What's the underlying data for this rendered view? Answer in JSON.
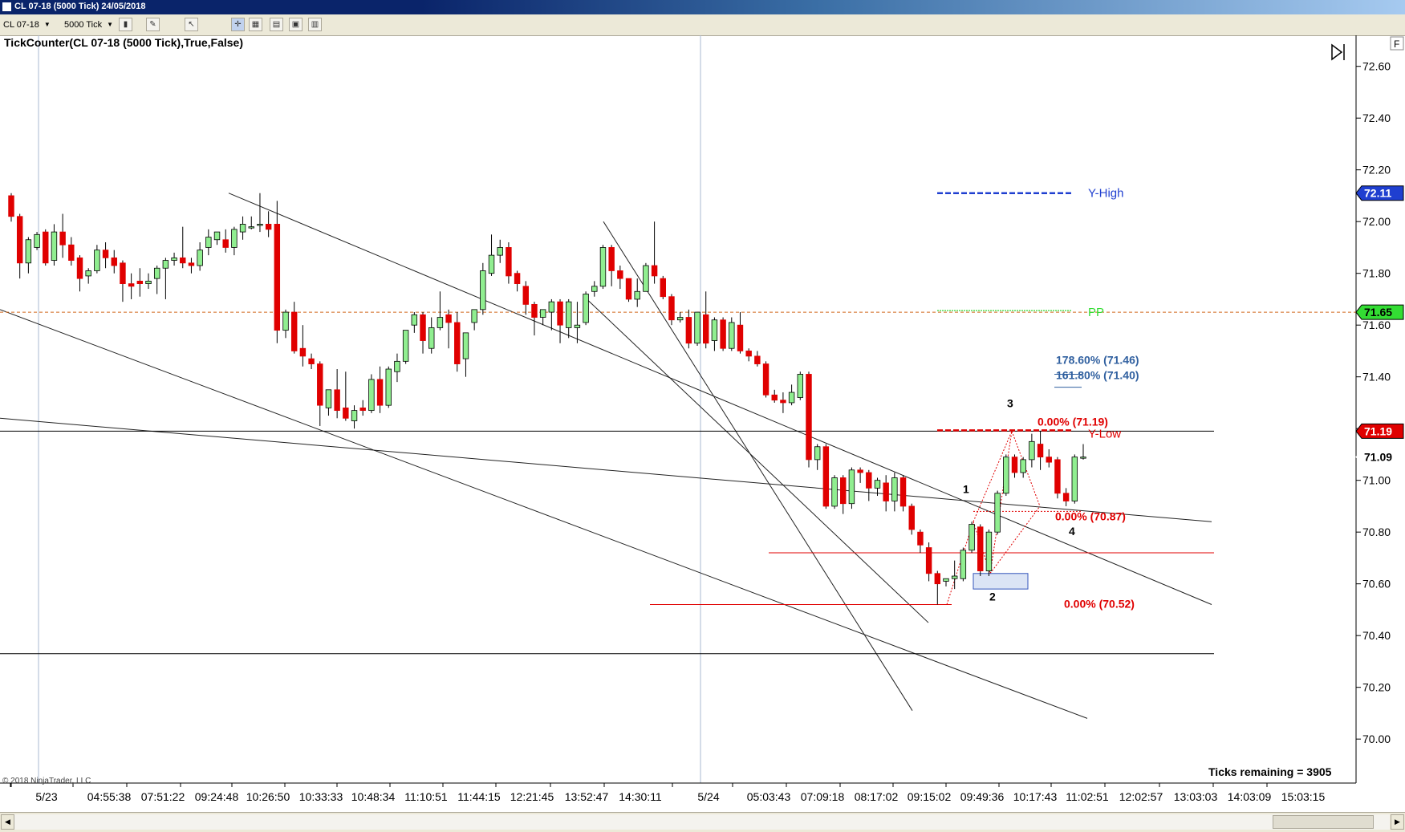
{
  "window": {
    "title": "CL 07-18 (5000 Tick)  24/05/2018"
  },
  "toolbar": {
    "instrument": "CL 07-18",
    "interval": "5000 Tick"
  },
  "icons": [
    "app-icon",
    "pencil-icon",
    "pointer-icon",
    "grid-icon",
    "chart-icon",
    "window-icon",
    "dropdown-icon",
    "f-icon",
    "play-icon"
  ],
  "chart_data": {
    "type": "candlestick",
    "title": "TickCounter(CL 07-18 (5000 Tick),True,False)",
    "yticks": [
      72.6,
      72.4,
      72.2,
      72.0,
      71.8,
      71.6,
      71.4,
      71.2,
      71.0,
      70.8,
      70.6,
      70.4,
      70.2,
      70.0
    ],
    "ytick_labels": [
      "72.60",
      "72.40",
      "72.20",
      "72.00",
      "71.80",
      "71.60",
      "71.40",
      "71.20",
      "71.00",
      "70.80",
      "70.60",
      "70.40",
      "70.20",
      "70.00"
    ],
    "ylim": [
      69.83,
      72.72
    ],
    "xtick_labels": [
      "5/23",
      "04:55:38",
      "07:51:22",
      "09:24:48",
      "10:26:50",
      "10:33:33",
      "10:48:34",
      "11:10:51",
      "11:44:15",
      "12:21:45",
      "13:52:47",
      "14:30:11",
      "5/24",
      "05:03:43",
      "07:09:18",
      "08:17:02",
      "09:15:02",
      "09:49:36",
      "10:17:43",
      "11:02:51",
      "12:02:57",
      "13:03:03",
      "14:03:09",
      "15:03:15"
    ],
    "candles": [
      {
        "o": 72.1,
        "h": 72.11,
        "c": 72.02,
        "l": 72.0
      },
      {
        "o": 72.02,
        "h": 72.03,
        "c": 71.84,
        "l": 71.78
      },
      {
        "o": 71.84,
        "h": 71.94,
        "c": 71.93,
        "l": 71.8
      },
      {
        "o": 71.9,
        "h": 71.96,
        "c": 71.95,
        "l": 71.89
      },
      {
        "o": 71.96,
        "h": 71.97,
        "c": 71.84,
        "l": 71.83
      },
      {
        "o": 71.85,
        "h": 71.99,
        "c": 71.96,
        "l": 71.83
      },
      {
        "o": 71.96,
        "h": 72.03,
        "c": 71.91,
        "l": 71.86
      },
      {
        "o": 71.91,
        "h": 71.94,
        "c": 71.85,
        "l": 71.83
      },
      {
        "o": 71.86,
        "h": 71.87,
        "c": 71.78,
        "l": 71.73
      },
      {
        "o": 71.79,
        "h": 71.82,
        "c": 71.81,
        "l": 71.76
      },
      {
        "o": 71.81,
        "h": 71.91,
        "c": 71.89,
        "l": 71.8
      },
      {
        "o": 71.89,
        "h": 71.92,
        "c": 71.86,
        "l": 71.82
      },
      {
        "o": 71.86,
        "h": 71.89,
        "c": 71.83,
        "l": 71.8
      },
      {
        "o": 71.84,
        "h": 71.85,
        "c": 71.76,
        "l": 71.69
      },
      {
        "o": 71.76,
        "h": 71.8,
        "c": 71.75,
        "l": 71.7
      },
      {
        "o": 71.77,
        "h": 71.82,
        "c": 71.76,
        "l": 71.71
      },
      {
        "o": 71.76,
        "h": 71.8,
        "c": 71.77,
        "l": 71.74
      },
      {
        "o": 71.78,
        "h": 71.83,
        "c": 71.82,
        "l": 71.72
      },
      {
        "o": 71.82,
        "h": 71.86,
        "c": 71.85,
        "l": 71.7
      },
      {
        "o": 71.85,
        "h": 71.88,
        "c": 71.86,
        "l": 71.83
      },
      {
        "o": 71.86,
        "h": 71.98,
        "c": 71.84,
        "l": 71.82
      },
      {
        "o": 71.84,
        "h": 71.86,
        "c": 71.83,
        "l": 71.8
      },
      {
        "o": 71.83,
        "h": 71.92,
        "c": 71.89,
        "l": 71.81
      },
      {
        "o": 71.9,
        "h": 71.97,
        "c": 71.94,
        "l": 71.87
      },
      {
        "o": 71.93,
        "h": 71.96,
        "c": 71.96,
        "l": 71.91
      },
      {
        "o": 71.93,
        "h": 71.97,
        "c": 71.9,
        "l": 71.88
      },
      {
        "o": 71.9,
        "h": 71.98,
        "c": 71.97,
        "l": 71.87
      },
      {
        "o": 71.96,
        "h": 72.02,
        "c": 71.99,
        "l": 71.93
      },
      {
        "o": 71.98,
        "h": 72.02,
        "c": 71.98,
        "l": 71.97
      },
      {
        "o": 71.99,
        "h": 72.11,
        "c": 71.99,
        "l": 71.96
      },
      {
        "o": 71.99,
        "h": 72.04,
        "c": 71.97,
        "l": 71.94
      },
      {
        "o": 71.99,
        "h": 72.08,
        "c": 71.58,
        "l": 71.53
      },
      {
        "o": 71.58,
        "h": 71.66,
        "c": 71.65,
        "l": 71.55
      },
      {
        "o": 71.65,
        "h": 71.69,
        "c": 71.5,
        "l": 71.49
      },
      {
        "o": 71.51,
        "h": 71.6,
        "c": 71.48,
        "l": 71.44
      },
      {
        "o": 71.47,
        "h": 71.49,
        "c": 71.45,
        "l": 71.43
      },
      {
        "o": 71.45,
        "h": 71.46,
        "c": 71.29,
        "l": 71.21
      },
      {
        "o": 71.28,
        "h": 71.34,
        "c": 71.35,
        "l": 71.25
      },
      {
        "o": 71.35,
        "h": 71.43,
        "c": 71.27,
        "l": 71.24
      },
      {
        "o": 71.28,
        "h": 71.42,
        "c": 71.24,
        "l": 71.23
      },
      {
        "o": 71.23,
        "h": 71.29,
        "c": 71.27,
        "l": 71.2
      },
      {
        "o": 71.28,
        "h": 71.31,
        "c": 71.27,
        "l": 71.25
      },
      {
        "o": 71.27,
        "h": 71.41,
        "c": 71.39,
        "l": 71.26
      },
      {
        "o": 71.39,
        "h": 71.44,
        "c": 71.29,
        "l": 71.26
      },
      {
        "o": 71.29,
        "h": 71.44,
        "c": 71.43,
        "l": 71.28
      },
      {
        "o": 71.42,
        "h": 71.49,
        "c": 71.46,
        "l": 71.38
      },
      {
        "o": 71.46,
        "h": 71.58,
        "c": 71.58,
        "l": 71.45
      },
      {
        "o": 71.6,
        "h": 71.65,
        "c": 71.64,
        "l": 71.57
      },
      {
        "o": 71.64,
        "h": 71.65,
        "c": 71.54,
        "l": 71.49
      },
      {
        "o": 71.51,
        "h": 71.63,
        "c": 71.59,
        "l": 71.49
      },
      {
        "o": 71.59,
        "h": 71.73,
        "c": 71.63,
        "l": 71.58
      },
      {
        "o": 71.64,
        "h": 71.66,
        "c": 71.61,
        "l": 71.51
      },
      {
        "o": 71.61,
        "h": 71.65,
        "c": 71.45,
        "l": 71.42
      },
      {
        "o": 71.47,
        "h": 71.54,
        "c": 71.57,
        "l": 71.4
      },
      {
        "o": 71.61,
        "h": 71.66,
        "c": 71.66,
        "l": 71.58
      },
      {
        "o": 71.66,
        "h": 71.84,
        "c": 71.81,
        "l": 71.64
      },
      {
        "o": 71.8,
        "h": 71.95,
        "c": 71.87,
        "l": 71.79
      },
      {
        "o": 71.87,
        "h": 71.93,
        "c": 71.9,
        "l": 71.84
      },
      {
        "o": 71.9,
        "h": 71.92,
        "c": 71.79,
        "l": 71.76
      },
      {
        "o": 71.8,
        "h": 71.81,
        "c": 71.76,
        "l": 71.73
      },
      {
        "o": 71.75,
        "h": 71.77,
        "c": 71.68,
        "l": 71.64
      },
      {
        "o": 71.68,
        "h": 71.69,
        "c": 71.63,
        "l": 71.56
      },
      {
        "o": 71.63,
        "h": 71.66,
        "c": 71.66,
        "l": 71.6
      },
      {
        "o": 71.65,
        "h": 71.7,
        "c": 71.69,
        "l": 71.58
      },
      {
        "o": 71.69,
        "h": 71.7,
        "c": 71.6,
        "l": 71.53
      },
      {
        "o": 71.59,
        "h": 71.7,
        "c": 71.69,
        "l": 71.55
      },
      {
        "o": 71.59,
        "h": 71.69,
        "c": 71.6,
        "l": 71.53
      },
      {
        "o": 71.61,
        "h": 71.73,
        "c": 71.72,
        "l": 71.6
      },
      {
        "o": 71.73,
        "h": 71.77,
        "c": 71.75,
        "l": 71.71
      },
      {
        "o": 71.75,
        "h": 71.91,
        "c": 71.9,
        "l": 71.74
      },
      {
        "o": 71.9,
        "h": 71.91,
        "c": 71.81,
        "l": 71.75
      },
      {
        "o": 71.81,
        "h": 71.83,
        "c": 71.78,
        "l": 71.74
      },
      {
        "o": 71.78,
        "h": 71.78,
        "c": 71.7,
        "l": 71.69
      },
      {
        "o": 71.7,
        "h": 71.78,
        "c": 71.73,
        "l": 71.67
      },
      {
        "o": 71.73,
        "h": 71.84,
        "c": 71.83,
        "l": 71.73
      },
      {
        "o": 71.83,
        "h": 72.0,
        "c": 71.79,
        "l": 71.76
      },
      {
        "o": 71.78,
        "h": 71.79,
        "c": 71.71,
        "l": 71.7
      },
      {
        "o": 71.71,
        "h": 71.72,
        "c": 71.62,
        "l": 71.6
      },
      {
        "o": 71.62,
        "h": 71.65,
        "c": 71.63,
        "l": 71.61
      },
      {
        "o": 71.63,
        "h": 71.66,
        "c": 71.53,
        "l": 71.51
      },
      {
        "o": 71.53,
        "h": 71.65,
        "c": 71.65,
        "l": 71.52
      },
      {
        "o": 71.64,
        "h": 71.73,
        "c": 71.53,
        "l": 71.51
      },
      {
        "o": 71.54,
        "h": 71.63,
        "c": 71.62,
        "l": 71.5
      },
      {
        "o": 71.62,
        "h": 71.63,
        "c": 71.51,
        "l": 71.5
      },
      {
        "o": 71.51,
        "h": 71.63,
        "c": 71.61,
        "l": 71.5
      },
      {
        "o": 71.6,
        "h": 71.65,
        "c": 71.5,
        "l": 71.49
      },
      {
        "o": 71.5,
        "h": 71.51,
        "c": 71.48,
        "l": 71.46
      },
      {
        "o": 71.48,
        "h": 71.5,
        "c": 71.45,
        "l": 71.44
      },
      {
        "o": 71.45,
        "h": 71.46,
        "c": 71.33,
        "l": 71.32
      },
      {
        "o": 71.33,
        "h": 71.35,
        "c": 71.31,
        "l": 71.3
      },
      {
        "o": 71.31,
        "h": 71.34,
        "c": 71.3,
        "l": 71.26
      },
      {
        "o": 71.3,
        "h": 71.37,
        "c": 71.34,
        "l": 71.29
      },
      {
        "o": 71.32,
        "h": 71.42,
        "c": 71.41,
        "l": 71.31
      },
      {
        "o": 71.41,
        "h": 71.42,
        "c": 71.08,
        "l": 71.05
      },
      {
        "o": 71.08,
        "h": 71.14,
        "c": 71.13,
        "l": 71.04
      },
      {
        "o": 71.13,
        "h": 71.14,
        "c": 70.9,
        "l": 70.89
      },
      {
        "o": 70.9,
        "h": 71.02,
        "c": 71.01,
        "l": 70.89
      },
      {
        "o": 71.01,
        "h": 71.02,
        "c": 70.91,
        "l": 70.87
      },
      {
        "o": 70.91,
        "h": 71.05,
        "c": 71.04,
        "l": 70.89
      },
      {
        "o": 71.04,
        "h": 71.05,
        "c": 71.03,
        "l": 70.99
      },
      {
        "o": 71.03,
        "h": 71.04,
        "c": 70.97,
        "l": 70.92
      },
      {
        "o": 70.97,
        "h": 71.01,
        "c": 71.0,
        "l": 70.94
      },
      {
        "o": 70.99,
        "h": 71.02,
        "c": 70.92,
        "l": 70.88
      },
      {
        "o": 70.92,
        "h": 71.03,
        "c": 71.01,
        "l": 70.88
      },
      {
        "o": 71.01,
        "h": 71.02,
        "c": 70.9,
        "l": 70.88
      },
      {
        "o": 70.9,
        "h": 70.91,
        "c": 70.81,
        "l": 70.79
      },
      {
        "o": 70.8,
        "h": 70.81,
        "c": 70.75,
        "l": 70.72
      },
      {
        "o": 70.74,
        "h": 70.76,
        "c": 70.64,
        "l": 70.61
      },
      {
        "o": 70.64,
        "h": 70.65,
        "c": 70.6,
        "l": 70.52
      },
      {
        "o": 70.61,
        "h": 70.62,
        "c": 70.62,
        "l": 70.59
      },
      {
        "o": 70.62,
        "h": 70.69,
        "c": 70.63,
        "l": 70.58
      },
      {
        "o": 70.62,
        "h": 70.74,
        "c": 70.73,
        "l": 70.61
      },
      {
        "o": 70.73,
        "h": 70.84,
        "c": 70.83,
        "l": 70.72
      },
      {
        "o": 70.82,
        "h": 70.83,
        "c": 70.65,
        "l": 70.63
      },
      {
        "o": 70.65,
        "h": 70.81,
        "c": 70.8,
        "l": 70.63
      },
      {
        "o": 70.8,
        "h": 70.96,
        "c": 70.95,
        "l": 70.79
      },
      {
        "o": 70.95,
        "h": 71.1,
        "c": 71.09,
        "l": 70.94
      },
      {
        "o": 71.09,
        "h": 71.1,
        "c": 71.03,
        "l": 71.01
      },
      {
        "o": 71.03,
        "h": 71.09,
        "c": 71.08,
        "l": 71.01
      },
      {
        "o": 71.08,
        "h": 71.18,
        "c": 71.15,
        "l": 71.05
      },
      {
        "o": 71.14,
        "h": 71.19,
        "c": 71.09,
        "l": 71.04
      },
      {
        "o": 71.09,
        "h": 71.12,
        "c": 71.07,
        "l": 71.05
      },
      {
        "o": 71.08,
        "h": 71.09,
        "c": 70.95,
        "l": 70.93
      },
      {
        "o": 70.95,
        "h": 70.97,
        "c": 70.92,
        "l": 70.9
      },
      {
        "o": 70.92,
        "h": 71.1,
        "c": 71.09,
        "l": 70.91
      },
      {
        "o": 71.09,
        "h": 71.14,
        "c": 71.09,
        "l": 71.08
      }
    ],
    "trendlines": [
      {
        "x1": 0,
        "y1": 71.24,
        "x2": 1510,
        "y2": 70.84
      },
      {
        "x1": 0,
        "y1": 71.66,
        "x2": 1355,
        "y2": 70.08
      },
      {
        "x1": 285,
        "y1": 72.11,
        "x2": 1510,
        "y2": 70.52
      },
      {
        "x1": 752,
        "y1": 72.0,
        "x2": 1137,
        "y2": 70.11
      },
      {
        "x1": 728,
        "y1": 71.71,
        "x2": 1157,
        "y2": 70.45
      }
    ],
    "hlines": [
      {
        "y": 71.19,
        "color": "#000000",
        "x1": 0,
        "x2": 1513
      },
      {
        "y": 70.33,
        "color": "#000000",
        "x1": 0,
        "x2": 1513
      },
      {
        "y": 70.72,
        "color": "#e00000",
        "x1": 958,
        "x2": 1513
      },
      {
        "y": 70.52,
        "color": "#e00000",
        "x1": 810,
        "x2": 1186
      }
    ],
    "pivot": {
      "y": 71.65,
      "color": "#d2691e",
      "label": "PP"
    },
    "yhigh": {
      "y": 72.11,
      "label": "Y-High",
      "color": "#1f3fd0"
    },
    "ylow": {
      "y": 71.19,
      "label": "Y-Low",
      "color": "#e00000"
    },
    "fib_labels": [
      {
        "text": "178.60% (71.46)",
        "y": 71.46,
        "color": "#2f5f9f"
      },
      {
        "text": "161.80% (71.40)",
        "y": 71.4,
        "color": "#2f5f9f"
      },
      {
        "text": "0.00% (71.19)",
        "y": 71.19,
        "color": "#e00000"
      },
      {
        "text": "0.00% (70.87)",
        "y": 70.87,
        "color": "#e00000"
      },
      {
        "text": "0.00% (70.52)",
        "y": 70.52,
        "color": "#e00000"
      }
    ],
    "wave_labels": [
      {
        "text": "1",
        "y": 70.96
      },
      {
        "text": "2",
        "y": 70.56
      },
      {
        "text": "3",
        "y": 71.27
      },
      {
        "text": "4",
        "y": 70.8
      }
    ],
    "price_markers": [
      {
        "text": "72.11",
        "bg": "#1f3fd0",
        "color": "#ffffff",
        "y": 72.11
      },
      {
        "text": "71.65",
        "bg": "#33dd33",
        "color": "#000000",
        "y": 71.65
      },
      {
        "text": "71.19",
        "bg": "#e00000",
        "color": "#ffffff",
        "y": 71.19
      },
      {
        "text": "71.09",
        "bg": "#ffffff",
        "color": "#000000",
        "y": 71.09
      }
    ],
    "colors": {
      "up": "#90ee90",
      "down": "#e00000",
      "outline": "#000000",
      "grid": "#aab8d0"
    },
    "copyright": "© 2018 NinjaTrader, LLC",
    "ticks_remaining": "Ticks remaining = 3905"
  }
}
